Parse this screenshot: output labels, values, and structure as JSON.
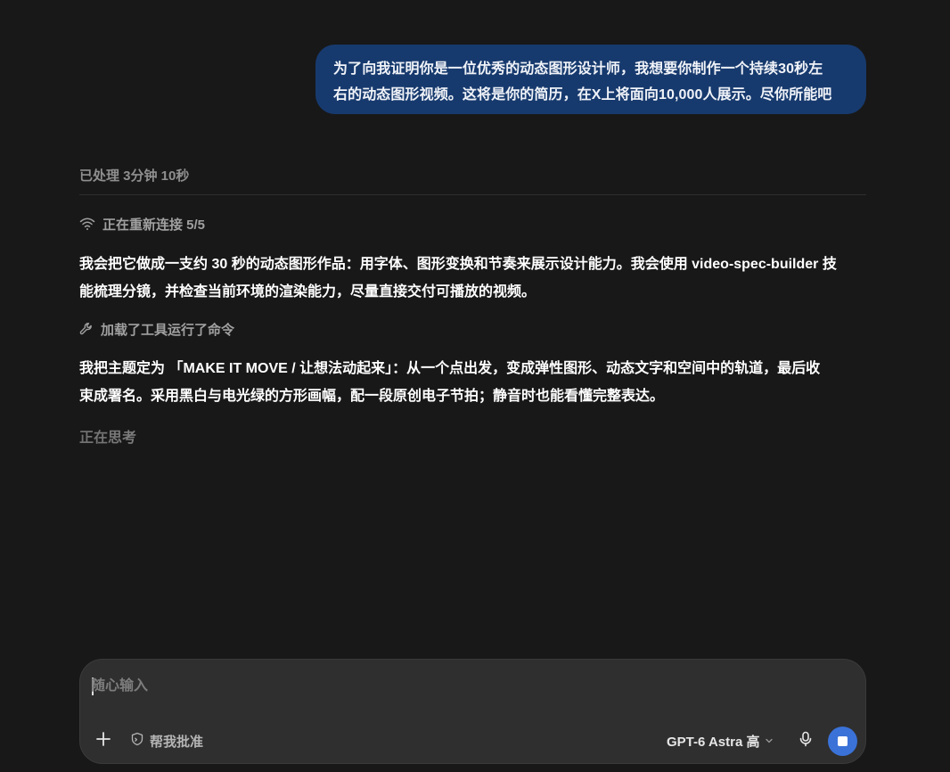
{
  "user_message": {
    "line1": "为了向我证明你是一位优秀的动态图形设计师，我想要你制作一个持续30秒左",
    "line2": "右的动态图形视频。这将是你的简历，在X上将面向10,000人展示。尽你所能吧"
  },
  "assistant": {
    "processed_label": "已处理 3分钟 10秒",
    "reconnect_label": "正在重新连接 5/5",
    "paragraph1_line1": "我会把它做成一支约 30 秒的动态图形作品：用字体、图形变换和节奏来展示设计能力。我会使用 video-spec-builder 技",
    "paragraph1_line2": "能梳理分镜，并检查当前环境的渲染能力，尽量直接交付可播放的视频。",
    "tools_label": "加载了工具运行了命令",
    "paragraph2_prefix": "我把主题定为 ",
    "paragraph2_strong": "「MAKE IT MOVE / 让想法动起来」",
    "paragraph2_rest_line1": "：从一个点出发，变成弹性图形、动态文字和空间中的轨道，最后收",
    "paragraph2_line2": "束成署名。采用黑白与电光绿的方形画幅，配一段原创电子节拍；静音时也能看懂完整表达。",
    "thinking_label": "正在思考"
  },
  "composer": {
    "placeholder": "随心输入",
    "approve_label": "帮我批准",
    "model_label": "GPT-6 Astra 高",
    "icons": {
      "add": "plus-icon",
      "approve": "shield-icon",
      "model": "chevron-down-icon",
      "mic": "microphone-icon",
      "stop": "stop-icon"
    }
  },
  "colors": {
    "background": "#181818",
    "user_bubble": "#173a6e",
    "composer": "#2f2f2f",
    "stop_button": "#3a72d8"
  }
}
